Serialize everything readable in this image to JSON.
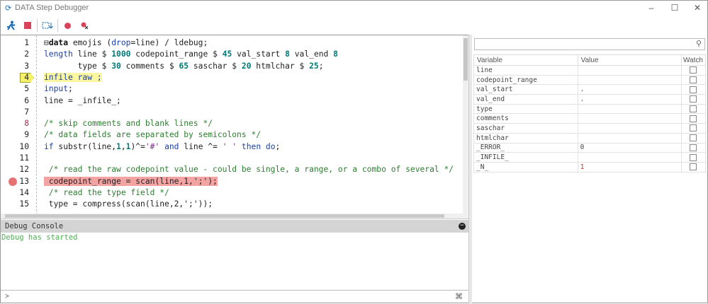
{
  "window": {
    "title": "DATA Step Debugger",
    "minimize": "–",
    "maximize": "☐",
    "close": "✕"
  },
  "toolbar": {
    "items": [
      "run-icon",
      "stop-icon",
      "step-icon",
      "breakpoint-icon",
      "clear-breakpoints-icon"
    ]
  },
  "editor": {
    "current_line": 4,
    "breakpoint_line": 13,
    "lines": [
      {
        "n": "1",
        "red": false,
        "tokens": [
          [
            "⊟",
            "pl"
          ],
          [
            "data",
            "bold"
          ],
          [
            " emojis (",
            "pl"
          ],
          [
            "drop",
            "kw"
          ],
          [
            "=line) / ldebug;",
            "pl"
          ]
        ]
      },
      {
        "n": "2",
        "red": false,
        "tokens": [
          [
            "length",
            "kw"
          ],
          [
            " line $ ",
            "pl"
          ],
          [
            "1000",
            "num"
          ],
          [
            " codepoint_range $ ",
            "pl"
          ],
          [
            "45",
            "num"
          ],
          [
            " val_start ",
            "pl"
          ],
          [
            "8",
            "num"
          ],
          [
            " val_end ",
            "pl"
          ],
          [
            "8",
            "num"
          ]
        ]
      },
      {
        "n": "3",
        "red": false,
        "tokens": [
          [
            "       type $ ",
            "pl"
          ],
          [
            "30",
            "num"
          ],
          [
            " comments $ ",
            "pl"
          ],
          [
            "65",
            "num"
          ],
          [
            " saschar $ ",
            "pl"
          ],
          [
            "20",
            "num"
          ],
          [
            " htmlchar $ ",
            "pl"
          ],
          [
            "25",
            "num"
          ],
          [
            ";",
            "pl"
          ]
        ]
      },
      {
        "n": "4",
        "red": false,
        "tokens": [
          [
            "infile raw ;",
            "kw"
          ]
        ]
      },
      {
        "n": "5",
        "red": false,
        "tokens": [
          [
            "input",
            "kw"
          ],
          [
            ";",
            "pl"
          ]
        ]
      },
      {
        "n": "6",
        "red": false,
        "tokens": [
          [
            "line = _infile_;",
            "pl"
          ]
        ]
      },
      {
        "n": "7",
        "red": false,
        "tokens": []
      },
      {
        "n": "8",
        "red": true,
        "tokens": [
          [
            "/* skip comments and blank lines */",
            "cm"
          ]
        ]
      },
      {
        "n": "9",
        "red": false,
        "tokens": [
          [
            "/* data fields are separated by semicolons */",
            "cm"
          ]
        ]
      },
      {
        "n": "10",
        "red": false,
        "tokens": [
          [
            "if",
            "kw"
          ],
          [
            " substr(line,",
            "pl"
          ],
          [
            "1",
            "num"
          ],
          [
            ",",
            "pl"
          ],
          [
            "1",
            "num"
          ],
          [
            ")^=",
            "pl"
          ],
          [
            "'#'",
            "str"
          ],
          [
            " and",
            "kw"
          ],
          [
            " line ^= ",
            "pl"
          ],
          [
            "' '",
            "str"
          ],
          [
            " then do",
            "kw"
          ],
          [
            ";",
            "pl"
          ]
        ]
      },
      {
        "n": "11",
        "red": false,
        "tokens": []
      },
      {
        "n": "12",
        "red": false,
        "tokens": [
          [
            " /* read the raw codepoint value - could be single, a range, or a combo of several */",
            "cm"
          ]
        ]
      },
      {
        "n": "13",
        "red": false,
        "tokens": [
          [
            " ",
            "pl"
          ],
          [
            "codepoint_range = scan(line,1,';');",
            "pl"
          ]
        ]
      },
      {
        "n": "14",
        "red": false,
        "tokens": [
          [
            " /* read the type field */",
            "cm"
          ]
        ]
      },
      {
        "n": "15",
        "red": false,
        "tokens": [
          [
            " type = compress(scan(line,2,';'));",
            "pl"
          ]
        ]
      }
    ]
  },
  "console": {
    "title": "Debug Console",
    "message": "Debug has started",
    "prompt": ">"
  },
  "variables": {
    "headers": [
      "Variable",
      "Value",
      "Watch"
    ],
    "rows": [
      {
        "name": "line",
        "value": "",
        "watch": false
      },
      {
        "name": "codepoint_range",
        "value": "",
        "watch": false
      },
      {
        "name": "val_start",
        "value": ".",
        "watch": false
      },
      {
        "name": "val_end",
        "value": ".",
        "watch": false
      },
      {
        "name": "type",
        "value": "",
        "watch": false
      },
      {
        "name": "comments",
        "value": "",
        "watch": false
      },
      {
        "name": "saschar",
        "value": "",
        "watch": false
      },
      {
        "name": "htmlchar",
        "value": "",
        "watch": false
      },
      {
        "name": "_ERROR_",
        "value": "0",
        "watch": false
      },
      {
        "name": "_INFILE_",
        "value": "",
        "watch": false
      },
      {
        "name": "_N_",
        "value": "1",
        "watch": false,
        "changed": true
      }
    ],
    "changed_color": "#d32f2f"
  }
}
